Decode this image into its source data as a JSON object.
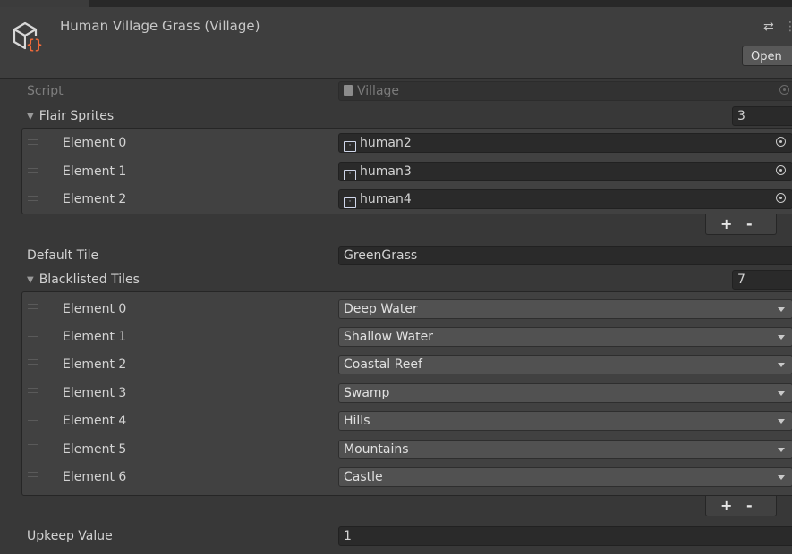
{
  "header": {
    "title": "Human Village Grass (Village)",
    "open_label": "Open",
    "settings_glyph": "⇄",
    "kebab_glyph": "⋮",
    "asset_icon": "scriptable-object-icon",
    "brace_color": "#f26b3a"
  },
  "script": {
    "label": "Script",
    "value": "Village"
  },
  "flair": {
    "label": "Flair Sprites",
    "size": "3",
    "elements": [
      {
        "label": "Element 0",
        "value": "human2"
      },
      {
        "label": "Element 1",
        "value": "human3"
      },
      {
        "label": "Element 2",
        "value": "human4"
      }
    ]
  },
  "default_tile": {
    "label": "Default Tile",
    "value": "GreenGrass"
  },
  "blacklisted": {
    "label": "Blacklisted Tiles",
    "size": "7",
    "elements": [
      {
        "label": "Element 0",
        "value": "Deep Water"
      },
      {
        "label": "Element 1",
        "value": "Shallow Water"
      },
      {
        "label": "Element 2",
        "value": "Coastal Reef"
      },
      {
        "label": "Element 3",
        "value": "Swamp"
      },
      {
        "label": "Element 4",
        "value": "Hills"
      },
      {
        "label": "Element 5",
        "value": "Mountains"
      },
      {
        "label": "Element 6",
        "value": "Castle"
      }
    ]
  },
  "upkeep": {
    "label": "Upkeep Value",
    "value": "1"
  },
  "list_controls": {
    "add": "+",
    "remove": "-"
  },
  "colors": {
    "background": "#383838",
    "field": "#2a2a2a",
    "dropdown": "#515151",
    "text": "#d2d2d2"
  }
}
